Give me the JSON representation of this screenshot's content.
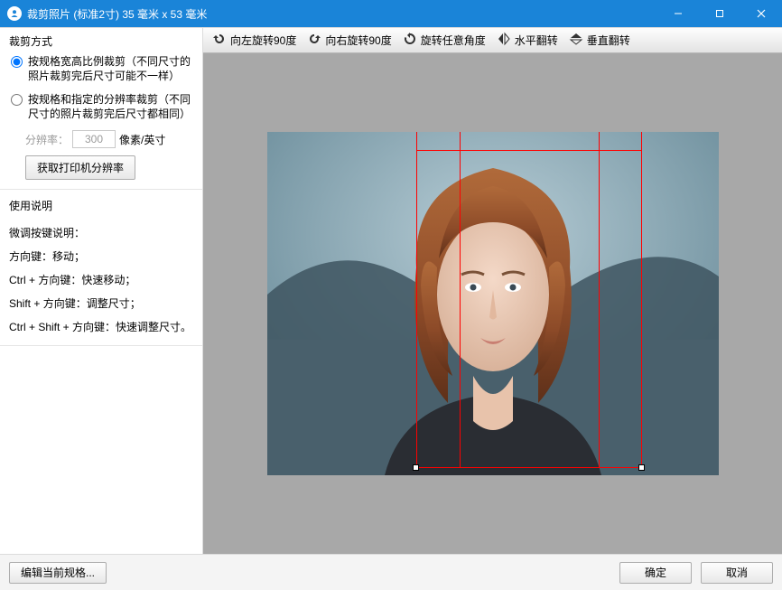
{
  "title": "裁剪照片 (标准2寸) 35 毫米 x 53 毫米",
  "sidebar": {
    "crop_mode": {
      "title": "裁剪方式",
      "opt1": "按规格宽高比例裁剪（不同尺寸的照片裁剪完后尺寸可能不一样）",
      "opt2": "按规格和指定的分辨率裁剪（不同尺寸的照片裁剪完后尺寸都相同）",
      "dpi_label": "分辨率：",
      "dpi_value": "300",
      "dpi_unit": "像素/英寸",
      "get_printer_dpi": "获取打印机分辨率"
    },
    "help": {
      "title": "使用说明",
      "l1": "微调按键说明：",
      "l2": "方向键：移动；",
      "l3": "Ctrl + 方向键：快速移动；",
      "l4": "Shift + 方向键：调整尺寸；",
      "l5": "Ctrl + Shift + 方向键：快速调整尺寸。"
    }
  },
  "toolbar": {
    "rotate_left": "向左旋转90度",
    "rotate_right": "向右旋转90度",
    "rotate_any": "旋转任意角度",
    "flip_h": "水平翻转",
    "flip_v": "垂直翻转"
  },
  "footer": {
    "edit_spec": "编辑当前规格...",
    "ok": "确定",
    "cancel": "取消"
  }
}
